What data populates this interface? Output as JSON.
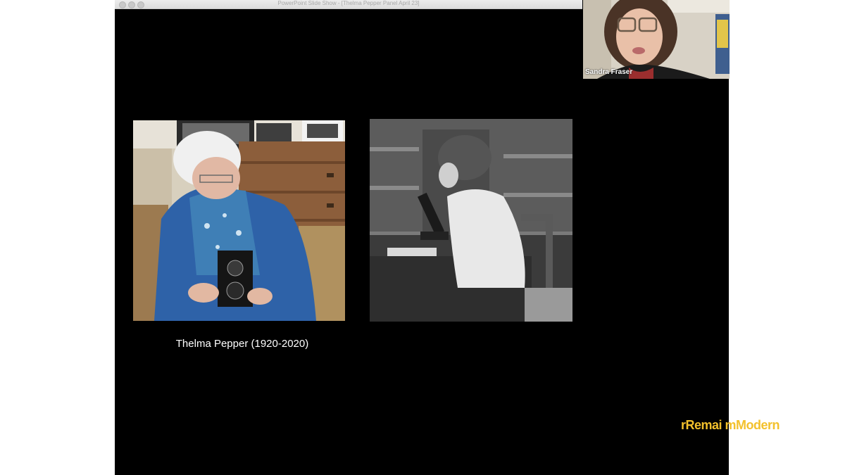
{
  "window": {
    "title": "PowerPoint Slide Show - [Thelma Pepper Panel April 23]"
  },
  "slide": {
    "caption": "Thelma Pepper (1920-2020)"
  },
  "video_tile": {
    "participant_name": "Sandra Fraser"
  },
  "watermark": {
    "text": "rRemai mModern",
    "color": "#f3c12c"
  }
}
